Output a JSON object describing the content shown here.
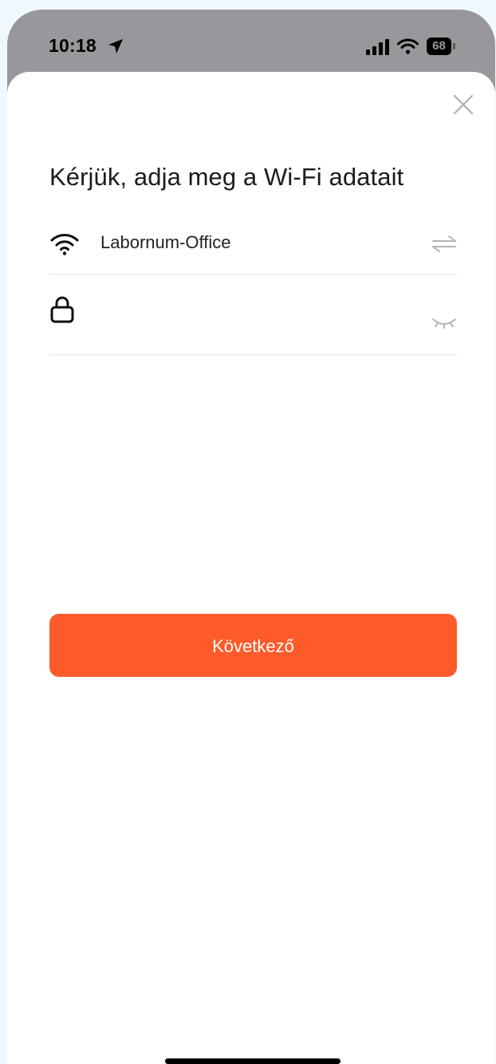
{
  "statusbar": {
    "time": "10:18",
    "battery": "68",
    "location_icon": "location-arrow-icon",
    "signal_icon": "cellular-signal-icon",
    "wifi_icon": "wifi-icon"
  },
  "sheet": {
    "close_icon": "close-icon",
    "title": "Kérjük, adja meg a Wi-Fi adatait",
    "ssid": {
      "icon": "wifi-icon",
      "value": "Labornum-Office",
      "action_icon": "swap-arrows-icon"
    },
    "password": {
      "icon": "lock-icon",
      "value": "",
      "placeholder": "",
      "action_icon": "eye-closed-icon"
    },
    "next_button": "Következő"
  },
  "colors": {
    "accent": "#ff5a2a",
    "background": "#eef8fd",
    "statusbar": "#98989c"
  }
}
